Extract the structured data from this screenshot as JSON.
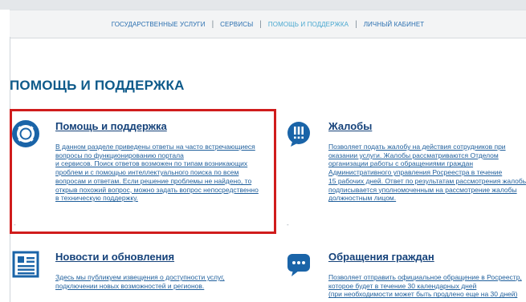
{
  "nav": {
    "items": [
      {
        "label": "ГОСУДАРСТВЕННЫЕ УСЛУГИ"
      },
      {
        "label": "СЕРВИСЫ"
      },
      {
        "label": "ПОМОЩЬ И ПОДДЕРЖКА"
      },
      {
        "label": "ЛИЧНЫЙ КАБИНЕТ"
      }
    ],
    "active_index": 2,
    "separator": "|"
  },
  "page": {
    "title": "ПОМОЩЬ И ПОДДЕРЖКА"
  },
  "sections": [
    {
      "title": "Помощь и поддержка",
      "icon": "lifebuoy-icon",
      "highlighted": true,
      "description": [
        "В данном разделе приведены ответы на часто встречающиеся",
        "вопросы по функционированию портала",
        "и сервисов. Поиск ответов возможен по типам возникающих",
        "проблем и с помощью интеллектуального поиска по всем",
        "вопросам и ответам. Если решение проблемы не найдено, то",
        "открыв похожий вопрос, можно задать вопрос непосредственно",
        "в техническую поддержку."
      ]
    },
    {
      "title": "Жалобы",
      "icon": "complaint-icon",
      "highlighted": false,
      "description": [
        "Позволяет подать жалобу на действия сотрудников при",
        "оказании услуги. Жалобы рассматриваются Отделом",
        "организации работы с обращениями граждан",
        "Административного управления Росреестра в течение",
        "15 рабочих дней. Ответ по результатам рассмотрения жалобы",
        "подписывается уполномоченным на рассмотрение жалобы",
        "должностным лицом."
      ]
    },
    {
      "title": "Новости и обновления",
      "icon": "news-icon",
      "highlighted": false,
      "description": [
        "Здесь мы публикуем извещения о доступности услуг,",
        "подключении новых возможностей и регионов."
      ]
    },
    {
      "title": "Обращения граждан",
      "icon": "chat-icon",
      "highlighted": false,
      "description": [
        "Позволяет отправить официальное обращение в Росреестр,",
        "которое будет в течение 30 календарных дней",
        "(при необходимости может быть продлено еще на 30 дней)"
      ]
    }
  ],
  "colors": {
    "accent": "#1a64a8",
    "highlight_border": "#d01c1c",
    "nav_active": "#4aa8d0"
  }
}
